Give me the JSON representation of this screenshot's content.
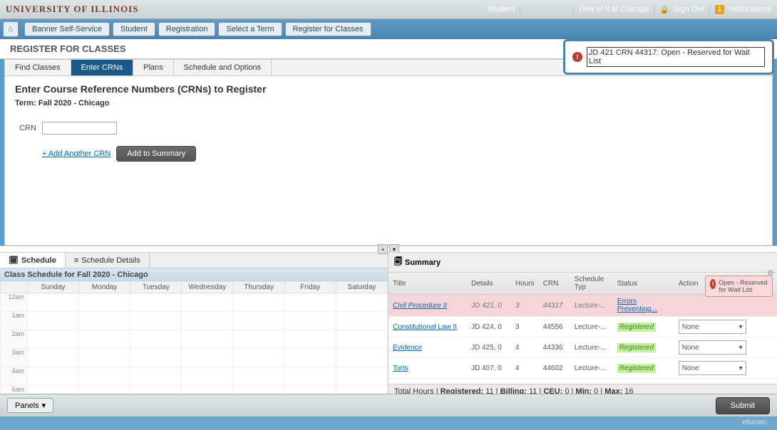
{
  "header": {
    "brand": "UNIVERSITY OF ILLINOIS",
    "student_label": "Student",
    "univ_link": "Univ of Il at Chicago",
    "signout": "Sign Out",
    "notif_count": "1",
    "notif_label": "Notifications"
  },
  "breadcrumb": [
    "Banner Self-Service",
    "Student",
    "Registration",
    "Select a Term",
    "Register for Classes"
  ],
  "notification_popup": "JD 421 CRN 44317: Open - Reserved for Wait List",
  "page_title": "REGISTER FOR CLASSES",
  "tabs": [
    "Find Classes",
    "Enter CRNs",
    "Plans",
    "Schedule and Options"
  ],
  "content": {
    "heading": "Enter Course Reference Numbers (CRNs) to Register",
    "term": "Term: Fall 2020 - Chicago",
    "crn_label": "CRN",
    "add_another": "+ Add Another CRN",
    "add_summary": "Add to Summary"
  },
  "schedule": {
    "tab1": "Schedule",
    "tab2": "Schedule Details",
    "title": "Class Schedule for Fall 2020 - Chicago",
    "days": [
      "Sunday",
      "Monday",
      "Tuesday",
      "Wednesday",
      "Thursday",
      "Friday",
      "Saturday"
    ],
    "hours": [
      "12am",
      "1am",
      "2am",
      "3am",
      "4am",
      "5am"
    ]
  },
  "summary": {
    "title": "Summary",
    "cols": [
      "Title",
      "Details",
      "Hours",
      "CRN",
      "Schedule Typ",
      "Status",
      "Action"
    ],
    "rows": [
      {
        "title": "Civil Procedure II",
        "details": "JD 421, 0",
        "hours": "3",
        "crn": "44317",
        "stype": "Lecture-...",
        "status": "Errors Preventing...",
        "action": ""
      },
      {
        "title": "Constitutional Law II",
        "details": "JD 424, 0",
        "hours": "3",
        "crn": "44556",
        "stype": "Lecture-...",
        "status": "Registered",
        "action": "None"
      },
      {
        "title": "Evidence",
        "details": "JD 425, 0",
        "hours": "4",
        "crn": "44336",
        "stype": "Lecture-...",
        "status": "Registered",
        "action": "None"
      },
      {
        "title": "Torts",
        "details": "JD 407, 0",
        "hours": "4",
        "crn": "44602",
        "stype": "Lecture-...",
        "status": "Registered",
        "action": "None"
      }
    ],
    "row_error_popup": "Open - Reserved for Wait List",
    "totals_prefix": "Total Hours | ",
    "totals": {
      "Registered": "11",
      "Billing": "11",
      "CEU": "0",
      "Min": "0",
      "Max": "16"
    }
  },
  "footer": {
    "panels": "Panels",
    "submit": "Submit",
    "brand": "ellucian."
  }
}
